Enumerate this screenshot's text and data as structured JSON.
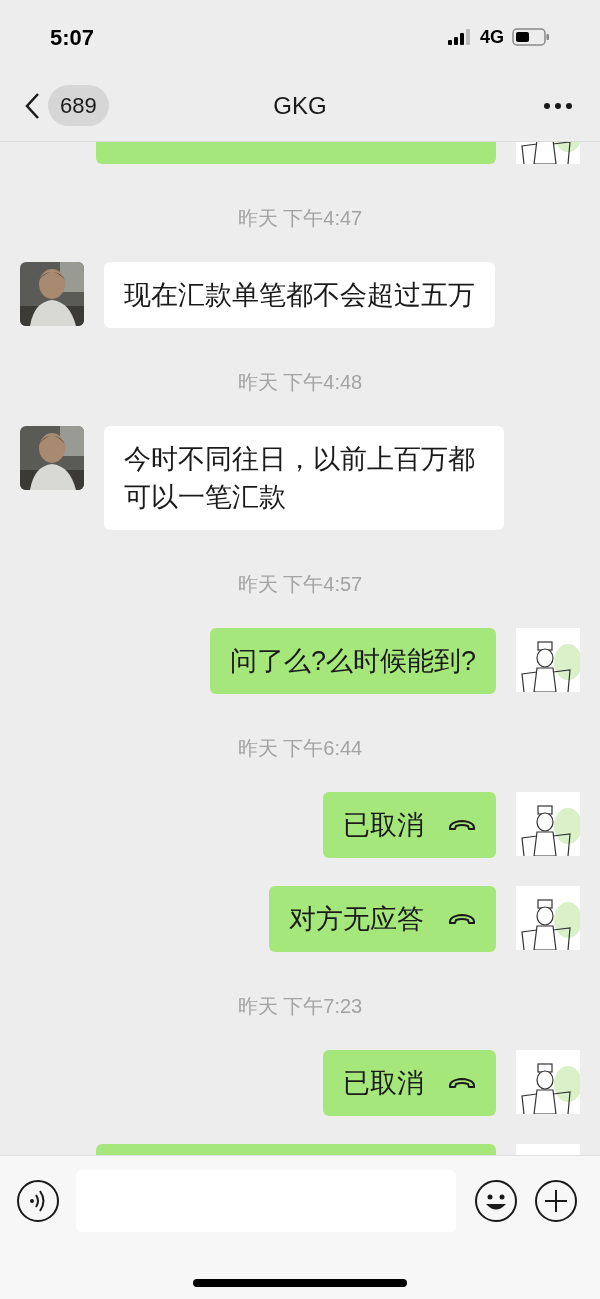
{
  "status_bar": {
    "time": "5:07",
    "network": "4G"
  },
  "nav": {
    "back_count": "689",
    "title": "GKG"
  },
  "messages": [
    {
      "kind": "clipped",
      "outgoing": true
    },
    {
      "kind": "time",
      "text": "昨天 下午4:47"
    },
    {
      "kind": "text",
      "outgoing": false,
      "text": "现在汇款单笔都不会超过五万"
    },
    {
      "kind": "time",
      "text": "昨天 下午4:48"
    },
    {
      "kind": "text",
      "outgoing": false,
      "text": "今时不同往日，以前上百万都可以一笔汇款"
    },
    {
      "kind": "time",
      "text": "昨天 下午4:57"
    },
    {
      "kind": "text",
      "outgoing": true,
      "text": "问了么?么时候能到?"
    },
    {
      "kind": "time",
      "text": "昨天 下午6:44"
    },
    {
      "kind": "call",
      "outgoing": true,
      "text": "已取消"
    },
    {
      "kind": "call",
      "outgoing": true,
      "text": "对方无应答"
    },
    {
      "kind": "time",
      "text": "昨天 下午7:23"
    },
    {
      "kind": "call",
      "outgoing": true,
      "text": "已取消"
    },
    {
      "kind": "clipped",
      "outgoing": true
    }
  ]
}
